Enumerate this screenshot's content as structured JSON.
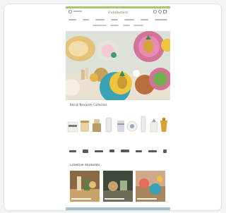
{
  "preview": {
    "site_logo": "Fiddlestick",
    "subhead": "Bekijk Nieuwste Collecties",
    "lifestyle_heading": "Lifestyle Moments"
  },
  "colors": {
    "top_bar": "#a7c76a",
    "hero_bg": "#d7ddd2",
    "pink_accent": "#d3739a",
    "teal_accent": "#3aa2b4",
    "footer_band": "#a9c2c8"
  },
  "icons": [
    "search-icon",
    "account-icon",
    "wishlist-icon",
    "cart-icon"
  ]
}
